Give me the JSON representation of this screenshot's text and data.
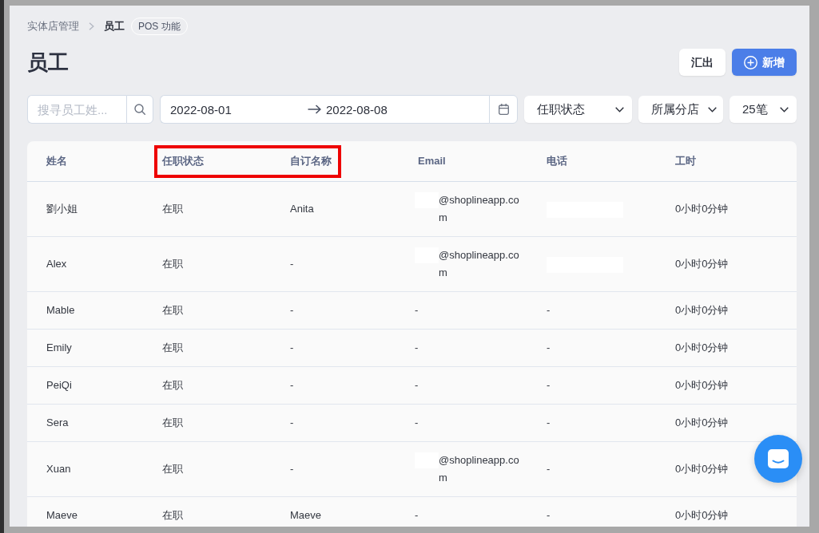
{
  "breadcrumb": {
    "items": [
      {
        "label": "实体店管理",
        "current": false
      },
      {
        "label": "员工",
        "current": true
      }
    ],
    "badge": "POS 功能"
  },
  "page_title": "员工",
  "actions": [
    {
      "label": "汇出",
      "kind": "secondary"
    },
    {
      "label": "新增",
      "kind": "primary"
    }
  ],
  "filters": {
    "search": {
      "placeholder": "搜寻员工姓..."
    },
    "date_range": {
      "start": "2022-08-01",
      "end": "2022-08-08"
    },
    "dropdowns": [
      "任职状态",
      "所属分店",
      "25笔"
    ]
  },
  "table": {
    "columns": [
      {
        "label": "姓名",
        "highlighted": false
      },
      {
        "label": "任职状态",
        "highlighted": true
      },
      {
        "label": "自订名称",
        "highlighted": true
      },
      {
        "label": "Email",
        "highlighted": false
      },
      {
        "label": "电话",
        "highlighted": false
      },
      {
        "label": "工时",
        "highlighted": false
      }
    ],
    "rows": [
      {
        "name": "劉小姐",
        "status": "在职",
        "custom_name": "Anita",
        "email": {
          "text": "@shoplineapp.com",
          "redacted": true
        },
        "phone": {
          "redacted": true
        },
        "hours": "0小时0分钟"
      },
      {
        "name": "Alex",
        "status": "在职",
        "custom_name": "-",
        "email": {
          "text": "@shoplineapp.com",
          "redacted": true
        },
        "phone": {
          "redacted": true
        },
        "hours": "0小时0分钟"
      },
      {
        "name": "Mable",
        "status": "在职",
        "custom_name": "-",
        "email": {
          "text": "-",
          "redacted": false
        },
        "phone": {
          "text": "-",
          "redacted": false
        },
        "hours": "0小时0分钟"
      },
      {
        "name": "Emily",
        "status": "在职",
        "custom_name": "-",
        "email": {
          "text": "-",
          "redacted": false
        },
        "phone": {
          "text": "-",
          "redacted": false
        },
        "hours": "0小时0分钟"
      },
      {
        "name": "PeiQi",
        "status": "在职",
        "custom_name": "-",
        "email": {
          "text": "-",
          "redacted": false
        },
        "phone": {
          "text": "-",
          "redacted": false
        },
        "hours": "0小时0分钟"
      },
      {
        "name": "Sera",
        "status": "在职",
        "custom_name": "-",
        "email": {
          "text": "-",
          "redacted": false
        },
        "phone": {
          "text": "-",
          "redacted": false
        },
        "hours": "0小时0分钟"
      },
      {
        "name": "Xuan",
        "status": "在职",
        "custom_name": "-",
        "email": {
          "text": "@shoplineapp.com",
          "redacted": true
        },
        "phone": {
          "text": "-",
          "redacted": false
        },
        "hours": "0小时0分钟"
      },
      {
        "name": "Maeve",
        "status": "在职",
        "custom_name": "Maeve",
        "email": {
          "text": "-",
          "redacted": false
        },
        "phone": {
          "text": "-",
          "redacted": false
        },
        "hours": "0小时0分钟"
      }
    ]
  }
}
